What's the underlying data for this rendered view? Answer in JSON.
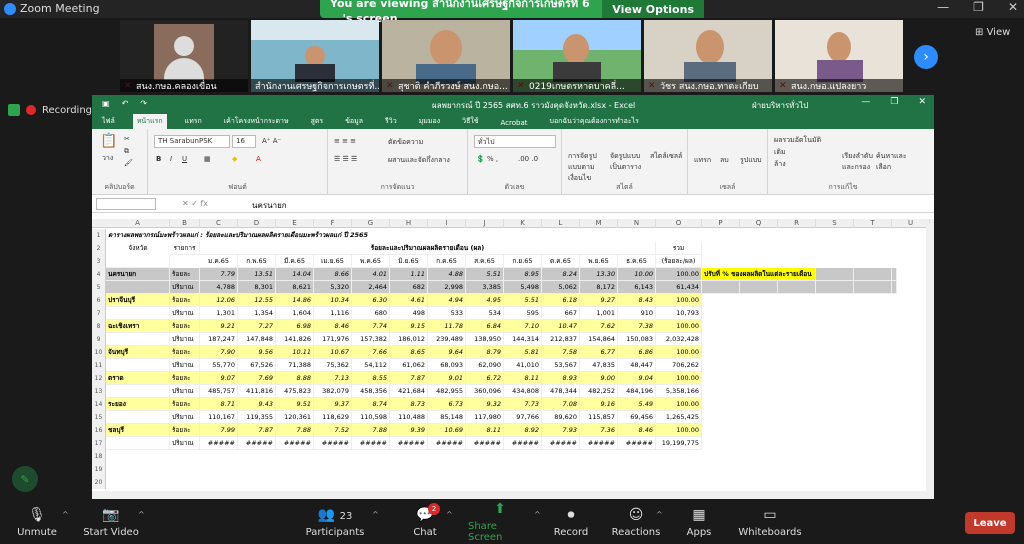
{
  "app": {
    "title": "Zoom Meeting"
  },
  "banner": {
    "text": "You are viewing สำนักงานเศรษฐกิจการเกษตรที่ 6 ...'s screen",
    "view_options": "View Options"
  },
  "participants": [
    {
      "name": "สนง.กษอ.คลองเขื่อน",
      "muted": true
    },
    {
      "name": "สำนักงานเศรษฐกิจการเกษตรที่...",
      "muted": false
    },
    {
      "name": "สุชาติ คำภีรวงษ์ สนง.กษอ...",
      "muted": true
    },
    {
      "name": "0219เกษตรหาดบาคลี่...",
      "muted": true
    },
    {
      "name": "วัชร สนง.กษอ.ทาตะเกียบ",
      "muted": true
    },
    {
      "name": "สนง.กษอ.แปลงยาว",
      "muted": true
    }
  ],
  "view_label": "View",
  "recording_label": "Recording",
  "excel": {
    "doc_title": "ผลพยากรณ์ ปี 2565 สศท.6 ราวมังคุดจังหวัด.xlsx - Excel",
    "user": "ฝ่ายบริหารทั่วไป",
    "tabs": [
      "ไฟล์",
      "หน้าแรก",
      "แทรก",
      "เค้าโครงหน้ากระดาษ",
      "สูตร",
      "ข้อมูล",
      "รีวิว",
      "มุมมอง",
      "วิธีใช้",
      "Acrobat",
      "บอกฉันว่าคุณต้องการทำอะไร"
    ],
    "active_tab": 1,
    "font_name": "TH SarabunPSK",
    "font_size": "16",
    "number_format": "ทั่วไป",
    "groups": [
      "คลิปบอร์ด",
      "ฟอนต์",
      "การจัดแนว",
      "ตัวเลข",
      "สไตล์",
      "เซลล์",
      "การแก้ไข"
    ],
    "ribbon_labels": {
      "paste": "วาง",
      "wrap": "ตัดข้อความ",
      "merge": "ผสานและจัดกึ่งกลาง",
      "cond_format": "การจัดรูปแบบตามเงื่อนไข",
      "table_format": "จัดรูปแบบเป็นตาราง",
      "cell_style": "สไตล์เซลล์",
      "insert": "แทรก",
      "delete": "ลบ",
      "format": "รูปแบบ",
      "autosum": "ผลรวมอัตโนมัติ",
      "fill": "เติม",
      "clear": "ล้าง",
      "sort": "เรียงลำดับและกรอง",
      "find": "ค้นหาและเลือก"
    },
    "name_box": "2R x 16384C",
    "formula_value": "นครนายก",
    "columns": [
      "A",
      "B",
      "C",
      "D",
      "E",
      "F",
      "G",
      "H",
      "I",
      "J",
      "K",
      "L",
      "M",
      "N",
      "O",
      "P",
      "Q",
      "R",
      "S",
      "T",
      "U"
    ],
    "sheet_title": "ตารางผลพยากรณ์มะพร้าวผลแก่ :  ร้อยละและปริมาณผลผลิตรายเดือนมะพร้าวผลแก่ ปี 2565",
    "header_main": "ร้อยละและปริมาณผลผลิตรายเดือน (ผล)",
    "header_total": "รวม",
    "header_unit": "(ร้อยละ/ผล)",
    "header_province": "จังหวัด",
    "header_list": "รายการ",
    "months": [
      "ม.ค.65",
      "ก.พ.65",
      "มี.ค.65",
      "เม.ย.65",
      "พ.ค.65",
      "มิ.ย.65",
      "ก.ค.65",
      "ส.ค.65",
      "ก.ย.65",
      "ต.ค.65",
      "พ.ย.65",
      "ธ.ค.65"
    ],
    "note": "ปรับที่ % ของผลผลิตในแต่ละรายเดือน",
    "rows": [
      {
        "prov": "นครนายก",
        "pct": [
          "7.79",
          "13.51",
          "14.04",
          "8.66",
          "4.01",
          "1.11",
          "4.88",
          "5.51",
          "8.95",
          "8.24",
          "13.30",
          "10.00"
        ],
        "pct_total": "100.00",
        "qty": [
          "4,788",
          "8,301",
          "8,621",
          "5,320",
          "2,464",
          "682",
          "2,998",
          "3,385",
          "5,498",
          "5,062",
          "8,172",
          "6,143"
        ],
        "qty_total": "61,434"
      },
      {
        "prov": "ปราจีนบุรี",
        "pct": [
          "12.06",
          "12.55",
          "14.86",
          "10.34",
          "6.30",
          "4.61",
          "4.94",
          "4.95",
          "5.51",
          "6.18",
          "9.27",
          "8.43"
        ],
        "pct_total": "100.00",
        "qty": [
          "1,301",
          "1,354",
          "1,604",
          "1,116",
          "680",
          "498",
          "533",
          "534",
          "595",
          "667",
          "1,001",
          "910"
        ],
        "qty_total": "10,793"
      },
      {
        "prov": "ฉะเชิงเทรา",
        "pct": [
          "9.21",
          "7.27",
          "6.98",
          "8.46",
          "7.74",
          "9.15",
          "11.78",
          "6.84",
          "7.10",
          "10.47",
          "7.62",
          "7.38"
        ],
        "pct_total": "100.00",
        "qty": [
          "187,247",
          "147,848",
          "141,826",
          "171,976",
          "157,382",
          "186,012",
          "239,489",
          "138,950",
          "144,314",
          "212,837",
          "154,864",
          "150,083"
        ],
        "qty_total": "2,032,428"
      },
      {
        "prov": "จันทบุรี",
        "pct": [
          "7.90",
          "9.56",
          "10.11",
          "10.67",
          "7.66",
          "8.65",
          "9.64",
          "8.79",
          "5.81",
          "7.58",
          "6.77",
          "6.86"
        ],
        "pct_total": "100.00",
        "qty": [
          "55,770",
          "67,526",
          "71,388",
          "75,362",
          "54,112",
          "61,062",
          "68,093",
          "62,090",
          "41,010",
          "53,567",
          "47,835",
          "48,447"
        ],
        "qty_total": "706,262"
      },
      {
        "prov": "ตราด",
        "pct": [
          "9.07",
          "7.69",
          "8.88",
          "7.13",
          "8.55",
          "7.87",
          "9.01",
          "6.72",
          "8.11",
          "8.93",
          "9.00",
          "9.04"
        ],
        "pct_total": "100.00",
        "qty": [
          "485,757",
          "411,816",
          "475,823",
          "382,079",
          "458,356",
          "421,684",
          "482,955",
          "360,096",
          "434,808",
          "478,344",
          "482,252",
          "484,196"
        ],
        "qty_total": "5,358,166"
      },
      {
        "prov": "ระยอง",
        "pct": [
          "8.71",
          "9.43",
          "9.51",
          "9.37",
          "8.74",
          "8.73",
          "6.73",
          "9.32",
          "7.73",
          "7.08",
          "9.16",
          "5.49"
        ],
        "pct_total": "100.00",
        "qty": [
          "110,167",
          "119,355",
          "120,361",
          "118,629",
          "110,598",
          "110,488",
          "85,148",
          "117,980",
          "97,766",
          "89,620",
          "115,857",
          "69,456"
        ],
        "qty_total": "1,265,425"
      },
      {
        "prov": "ชลบุรี",
        "pct": [
          "7.99",
          "7.87",
          "7.88",
          "7.52",
          "7.88",
          "9.39",
          "10.69",
          "8.11",
          "8.92",
          "7.93",
          "7.36",
          "8.46"
        ],
        "pct_total": "100.00",
        "qty": [
          "#####",
          "#####",
          "#####",
          "#####",
          "#####",
          "#####",
          "#####",
          "#####",
          "#####",
          "#####",
          "#####",
          "#####"
        ],
        "qty_total": "19,199,775"
      }
    ],
    "row_pct_label": "ร้อยละ",
    "row_qty_label": "ปริมาณ"
  },
  "toolbar": {
    "unmute": "Unmute",
    "start_video": "Start Video",
    "participants": "Participants",
    "participants_count": "23",
    "chat": "Chat",
    "chat_badge": "2",
    "share": "Share Screen",
    "record": "Record",
    "reactions": "Reactions",
    "apps": "Apps",
    "whiteboards": "Whiteboards",
    "leave": "Leave"
  }
}
